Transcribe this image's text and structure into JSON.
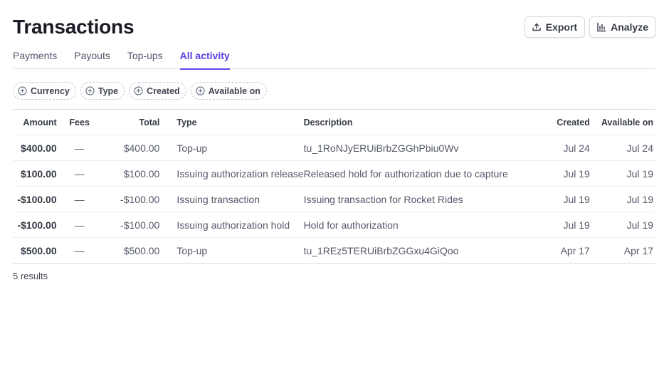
{
  "page": {
    "title": "Transactions"
  },
  "header": {
    "export_label": "Export",
    "analyze_label": "Analyze"
  },
  "tabs": [
    {
      "label": "Payments",
      "active": false
    },
    {
      "label": "Payouts",
      "active": false
    },
    {
      "label": "Top-ups",
      "active": false
    },
    {
      "label": "All activity",
      "active": true
    }
  ],
  "filters": [
    {
      "label": "Currency"
    },
    {
      "label": "Type"
    },
    {
      "label": "Created"
    },
    {
      "label": "Available on"
    }
  ],
  "table": {
    "columns": [
      "Amount",
      "Fees",
      "Total",
      "Type",
      "Description",
      "Created",
      "Available on"
    ],
    "rows": [
      {
        "amount": "$400.00",
        "fees": "—",
        "total": "$400.00",
        "type": "Top-up",
        "description": "tu_1RoNJyERUiBrbZGGhPbiu0Wv",
        "created": "Jul 24",
        "available_on": "Jul 24"
      },
      {
        "amount": "$100.00",
        "fees": "—",
        "total": "$100.00",
        "type": "Issuing authorization release",
        "description": "Released hold for authorization due to capture",
        "created": "Jul 19",
        "available_on": "Jul 19"
      },
      {
        "amount": "-$100.00",
        "fees": "—",
        "total": "-$100.00",
        "type": "Issuing transaction",
        "description": "Issuing transaction for Rocket Rides",
        "created": "Jul 19",
        "available_on": "Jul 19"
      },
      {
        "amount": "-$100.00",
        "fees": "—",
        "total": "-$100.00",
        "type": "Issuing authorization hold",
        "description": "Hold for authorization",
        "created": "Jul 19",
        "available_on": "Jul 19"
      },
      {
        "amount": "$500.00",
        "fees": "—",
        "total": "$500.00",
        "type": "Top-up",
        "description": "tu_1REz5TERUiBrbZGGxu4GiQoo",
        "created": "Apr 17",
        "available_on": "Apr 17"
      }
    ]
  },
  "footer": {
    "results_text": "5 results"
  },
  "colors": {
    "accent": "#5b3fe0",
    "text": "#30313d",
    "muted": "#545969",
    "border": "#d8dee4"
  },
  "icons": {
    "export": "export-icon",
    "analyze": "bar-chart-icon",
    "filter_add": "plus-circle-icon"
  }
}
